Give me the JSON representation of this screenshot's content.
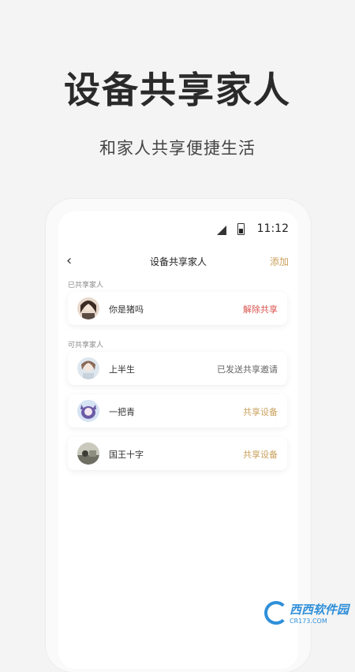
{
  "hero": {
    "title": "设备共享家人",
    "subtitle": "和家人共享便捷生活"
  },
  "status_bar": {
    "time": "11:12"
  },
  "nav": {
    "back_icon": "chevron-left",
    "title": "设备共享家人",
    "add_label": "添加"
  },
  "shared": {
    "label": "已共享家人",
    "items": [
      {
        "name": "你是猪吗",
        "action": "解除共享",
        "action_color": "#d9534f"
      }
    ]
  },
  "available": {
    "label": "可共享家人",
    "items": [
      {
        "name": "上半生",
        "action": "已发送共享邀请",
        "action_color": "#666666"
      },
      {
        "name": "一把青",
        "action": "共享设备",
        "action_color": "#c9a15c"
      },
      {
        "name": "国王十字",
        "action": "共享设备",
        "action_color": "#c9a15c"
      }
    ]
  },
  "watermark": {
    "brand": "西西软件园",
    "domain": "CR173.COM"
  },
  "colors": {
    "accent": "#c9a15c",
    "danger": "#d9534f",
    "watermark": "#2f8fd9"
  }
}
